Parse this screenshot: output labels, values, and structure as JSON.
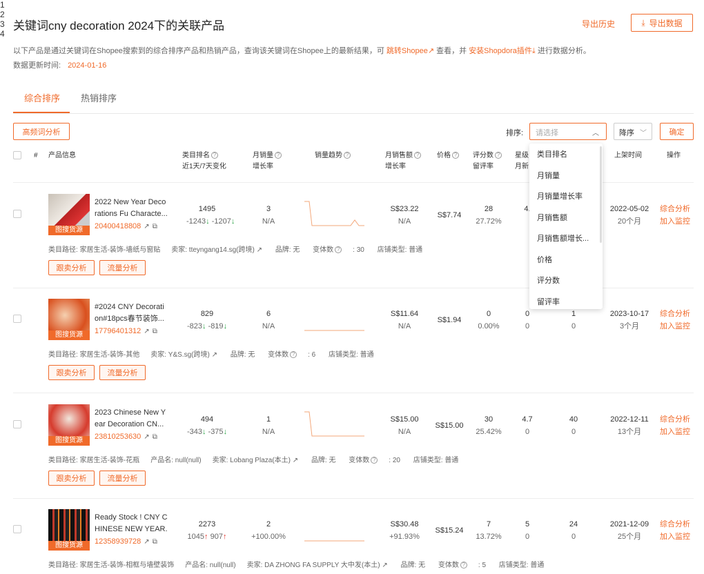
{
  "header": {
    "title": "关键词cny decoration 2024下的关联产品",
    "history": "导出历史",
    "export": "导出数据"
  },
  "desc": {
    "part1": "以下产品是通过关键词在Shopee搜索到的综合排序产品和热销产品，查询该关键词在Shopee上的最新结果，可 ",
    "link1": "跳转Shopee",
    "part2": " 查看，并 ",
    "link2": "安装Shopdora插件",
    "part3": " 进行数据分析。"
  },
  "update": {
    "label": "数据更新时间:",
    "date": "2024-01-16"
  },
  "tabs": [
    "综合排序",
    "热销排序"
  ],
  "toolbar": {
    "keyword_btn": "高频词分析",
    "sort_label": "排序:",
    "sort_placeholder": "请选择",
    "order": "降序",
    "confirm": "确定"
  },
  "columns": {
    "num": "#",
    "product": "产品信息",
    "cat_rank": "类目排名",
    "cat_rank_sub": "近1天/7天变化",
    "msales": "月销量",
    "msales_sub": "增长率",
    "trend": "销量趋势",
    "mrev": "月销售额",
    "mrev_sub": "增长率",
    "price": "价格",
    "rating": "评分数",
    "rating_sub": "留评率",
    "star": "星级",
    "star_sub": "月新",
    "listed": "上架时间",
    "ops": "操作"
  },
  "sort_options": [
    "类目排名",
    "月销量",
    "月销量增长率",
    "月销售额",
    "月销售额增长...",
    "价格",
    "评分数",
    "留评率"
  ],
  "labels": {
    "badge": "图搜货源",
    "path": "类目路径:",
    "seller": "卖家:",
    "brand": "品牌:",
    "variants": "变体数",
    "shoptype": "店铺类型:",
    "pname_label": "产品名:",
    "op1": "综合分析",
    "op2": "加入监控",
    "follow": "跟卖分析",
    "traffic": "流量分析"
  },
  "rows": [
    {
      "idx": "1",
      "name1": "2022 New Year Deco",
      "name2": "rations Fu Characte...",
      "id": "20400418808",
      "rank": "1495",
      "d1": "-1243",
      "d7": "-1207",
      "d1dir": "down",
      "d7dir": "down",
      "msales": "3",
      "mgrowth": "N/A",
      "mrev": "S$23.22",
      "rgrowth": "N/A",
      "price": "S$7.74",
      "rating": "28",
      "rrate": "27.72%",
      "star": "4.",
      "star2": "",
      "listed": "2022-05-02",
      "age": "20个月",
      "path": "家居生活-装饰-墙纸与窗贴",
      "pname": "",
      "seller": "tteyngang14.sg(跨境)",
      "brand": "无",
      "variants": "30",
      "shoptype": "普通"
    },
    {
      "idx": "2",
      "name1": "#2024 CNY Decorati",
      "name2": "on#18pcs春节装饰...",
      "id": "17796401312",
      "rank": "829",
      "d1": "-823",
      "d7": "-819",
      "d1dir": "down",
      "d7dir": "down",
      "msales": "6",
      "mgrowth": "N/A",
      "mrev": "S$11.64",
      "rgrowth": "N/A",
      "price": "S$1.94",
      "rating": "0",
      "rrate": "0.00%",
      "star": "0",
      "star2": "0",
      "extra": "1",
      "extra2": "0",
      "listed": "2023-10-17",
      "age": "3个月",
      "path": "家居生活-装饰-其他",
      "pname": "",
      "seller": "Y&S.sg(跨境)",
      "brand": "无",
      "variants": "6",
      "shoptype": "普通"
    },
    {
      "idx": "3",
      "name1": "2023 Chinese New Y",
      "name2": "ear Decoration CN...",
      "id": "23810253630",
      "rank": "494",
      "d1": "-343",
      "d7": "-375",
      "d1dir": "down",
      "d7dir": "down",
      "msales": "1",
      "mgrowth": "N/A",
      "mrev": "S$15.00",
      "rgrowth": "N/A",
      "price": "S$15.00",
      "rating": "30",
      "rrate": "25.42%",
      "star": "4.7",
      "star2": "0",
      "extra": "40",
      "extra2": "0",
      "listed": "2022-12-11",
      "age": "13个月",
      "path": "家居生活-装饰-花瓶",
      "pname": "null(null)",
      "seller": "Lobang Plaza(本土)",
      "brand": "无",
      "variants": "20",
      "shoptype": "普通"
    },
    {
      "idx": "4",
      "name1": "Ready Stock ! CNY C",
      "name2": "HINESE NEW YEAR...",
      "id": "12358939728",
      "rank": "2273",
      "d1": "1045",
      "d7": "907",
      "d1dir": "up",
      "d7dir": "up",
      "msales": "2",
      "mgrowth": "+100.00%",
      "mrev": "S$30.48",
      "rgrowth": "+91.93%",
      "price": "S$15.24",
      "rating": "7",
      "rrate": "13.72%",
      "star": "5",
      "star2": "0",
      "extra": "24",
      "extra2": "0",
      "listed": "2021-12-09",
      "age": "25个月",
      "path": "家居生活-装饰-相框与墙壁装饰",
      "pname": "null(null)",
      "seller": "DA ZHONG FA SUPPLY 大中发(本土)",
      "brand": "无",
      "variants": "5",
      "shoptype": "普通"
    }
  ],
  "colors": {
    "accent": "#f06a2a",
    "up": "#e0332b",
    "down": "#2aa345"
  }
}
